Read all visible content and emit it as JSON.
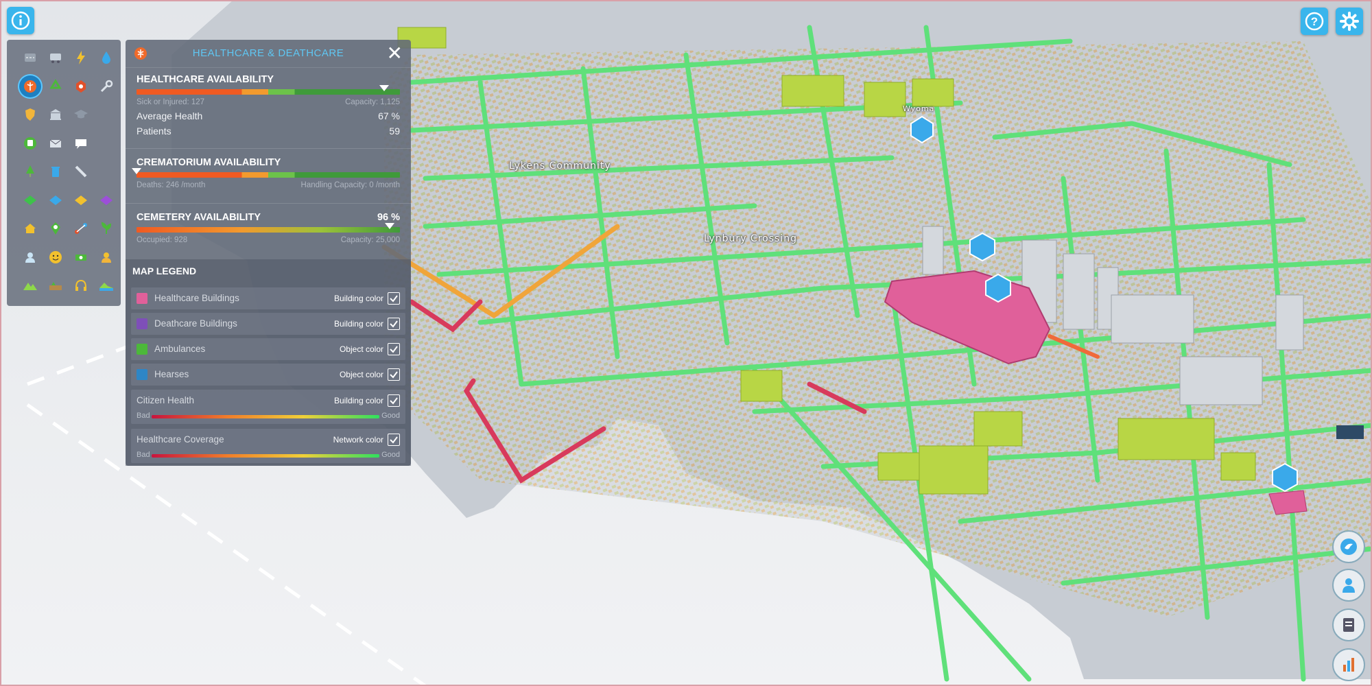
{
  "top_bar": {
    "info_icon": "info-icon",
    "help_icon": "help-icon",
    "settings_icon": "gear-icon"
  },
  "toolbar": {
    "tools": [
      "roads-icon",
      "transport-icon",
      "electricity-icon",
      "water-icon",
      "healthcare-icon",
      "recycle-icon",
      "fire-icon",
      "wrench-icon",
      "police-icon",
      "education-building-icon",
      "graduation-icon",
      "",
      "bus-icon",
      "mail-icon",
      "chat-icon",
      "",
      "tree-icon",
      "trash-icon",
      "pipe-icon",
      "",
      "residential-zone-icon",
      "commercial-zone-icon",
      "industrial-zone-icon",
      "office-zone-icon",
      "house-icon",
      "map-pin-icon",
      "route-icon",
      "plant-icon",
      "citizens-icon",
      "happiness-icon",
      "money-icon",
      "worker-icon",
      "terrain-icon",
      "soil-icon",
      "headphones-icon",
      "water-terrain-icon"
    ],
    "active_index": 4
  },
  "panel": {
    "title": "HEALTHCARE & DEATHCARE",
    "close_label": "✕",
    "healthcare": {
      "heading": "HEALTHCARE AVAILABILITY",
      "sick_label": "Sick or Injured: 127",
      "capacity_label": "Capacity: 1,125",
      "availability_fraction": 0.94,
      "rows": [
        {
          "label": "Average Health",
          "value": "67 %"
        },
        {
          "label": "Patients",
          "value": "59"
        }
      ]
    },
    "crematorium": {
      "heading": "CREMATORIUM AVAILABILITY",
      "deaths_label": "Deaths: 246 /month",
      "capacity_label": "Handling Capacity: 0 /month",
      "availability_fraction": 0.0
    },
    "cemetery": {
      "heading": "CEMETERY AVAILABILITY",
      "value": "96 %",
      "occupied_label": "Occupied: 928",
      "capacity_label": "Capacity: 25,000",
      "availability_fraction": 0.96
    },
    "legend": {
      "heading": "MAP LEGEND",
      "items": [
        {
          "label": "Healthcare Buildings",
          "mode": "Building color",
          "color": "#e0609a",
          "checked": true
        },
        {
          "label": "Deathcare Buildings",
          "mode": "Building color",
          "color": "#7e4fb8",
          "checked": true
        },
        {
          "label": "Ambulances",
          "mode": "Object color",
          "color": "#4cb83a",
          "checked": true
        },
        {
          "label": "Hearses",
          "mode": "Object color",
          "color": "#2e86c6",
          "checked": true
        }
      ],
      "gradients": [
        {
          "label": "Citizen Health",
          "mode": "Building color",
          "bad": "Bad",
          "good": "Good",
          "checked": true
        },
        {
          "label": "Healthcare Coverage",
          "mode": "Network color",
          "bad": "Bad",
          "good": "Good",
          "checked": true
        }
      ]
    }
  },
  "map": {
    "labels": [
      "Lykens Community",
      "Lynbury Crossing",
      "Wyoma"
    ],
    "network_colors": {
      "good": "#5fe07a",
      "medium": "#f0a53a",
      "bad": "#d83a5c"
    },
    "healthcare_building_color": "#e0609a"
  },
  "side_buttons": [
    "chirper-icon",
    "citizen-icon",
    "notes-icon",
    "sound-icon"
  ]
}
